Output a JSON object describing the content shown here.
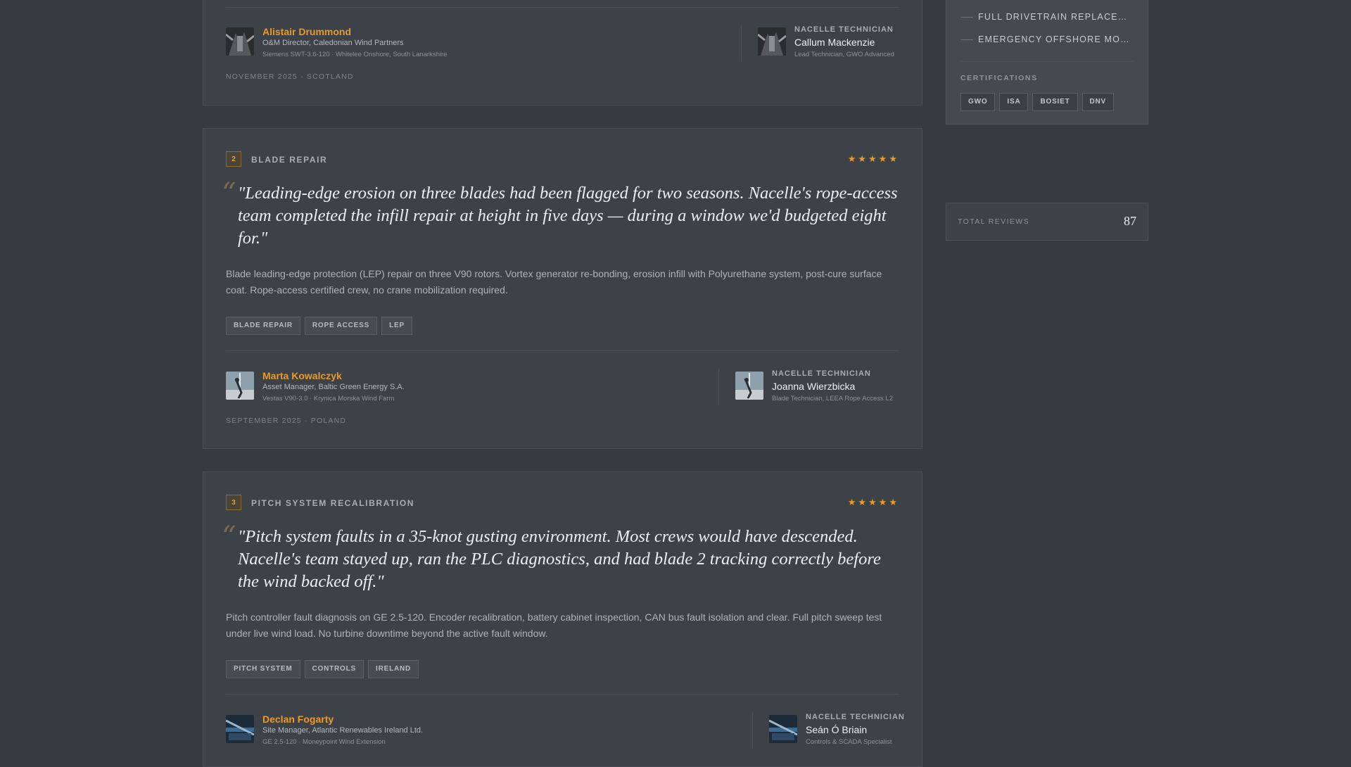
{
  "review1_tail": {
    "client": {
      "name": "Alistair Drummond",
      "role": "O&M Director, Caledonian Wind Partners",
      "site": "Siemens SWT-3.6-120 · Whitelee Onshore, South Lanarkshire"
    },
    "technician": {
      "label": "Nacelle Technician",
      "name": "Callum Mackenzie",
      "title": "Lead Technician, GWO Advanced"
    },
    "meta": "November 2025 · Scotland"
  },
  "review2": {
    "number": "2",
    "category": "Blade Repair",
    "stars": "★★★★★",
    "quote_mark": "“",
    "quote": "\"Leading-edge erosion on three blades had been flagged for two seasons. Nacelle's rope-access team completed the infill repair at height in five days — during a window we'd budgeted eight for.\"",
    "description": "Blade leading-edge protection (LEP) repair on three V90 rotors. Vortex generator re-bonding, erosion infill with Polyurethane system, post-cure surface coat. Rope-access certified crew, no crane mobilization required.",
    "tags": [
      "Blade Repair",
      "Rope Access",
      "LEP"
    ],
    "client": {
      "name": "Marta Kowalczyk",
      "role": "Asset Manager, Baltic Green Energy S.A.",
      "site": "Vestas V90-3.0 · Krynica Morska Wind Farm"
    },
    "technician": {
      "label": "Nacelle Technician",
      "name": "Joanna Wierzbicka",
      "title": "Blade Technician, LEEA Rope Access L2"
    },
    "meta": "September 2025 · Poland"
  },
  "review3": {
    "number": "3",
    "category": "Pitch System Recalibration",
    "stars": "★★★★★",
    "quote_mark": "“",
    "quote": "\"Pitch system faults in a 35-knot gusting environment. Most crews would have descended. Nacelle's team stayed up, ran the PLC diagnostics, and had blade 2 tracking correctly before the wind backed off.\"",
    "description": "Pitch controller fault diagnosis on GE 2.5-120. Encoder recalibration, battery cabinet inspection, CAN bus fault isolation and clear. Full pitch sweep test under live wind load. No turbine downtime beyond the active fault window.",
    "tags": [
      "Pitch System",
      "Controls",
      "Ireland"
    ],
    "client": {
      "name": "Declan Fogarty",
      "role": "Site Manager, Atlantic Renewables Ireland Ltd.",
      "site": "GE 2.5-120 · Moneypoint Wind Extension"
    },
    "technician": {
      "label": "Nacelle Technician",
      "name": "Seán Ó Briain",
      "title": "Controls & SCADA Specialist"
    }
  },
  "sidebar": {
    "services": [
      "Full Drivetrain Replacement",
      "Emergency Offshore Mobili..."
    ],
    "cert_title": "Certifications",
    "certs": [
      "GWO",
      "ISA",
      "BOSIET",
      "DNV"
    ],
    "stat_label": "Total Reviews",
    "stat_value": "87"
  },
  "colors": {
    "accent": "#e89a2a",
    "background": "#363a41",
    "card": "#3d4148"
  },
  "icons": [
    "avatar-photo-icon",
    "star-icon",
    "quote-icon"
  ]
}
